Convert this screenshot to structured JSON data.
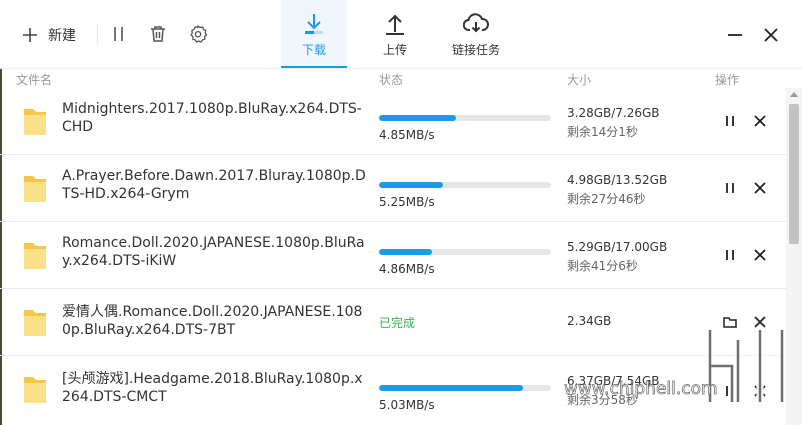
{
  "toolbar": {
    "new_label": "新建",
    "pause_icon": "pause-all-icon",
    "delete_icon": "trash-icon",
    "settings_icon": "gear-icon"
  },
  "tabs": [
    {
      "label": "下载",
      "icon": "download-icon",
      "active": true
    },
    {
      "label": "上传",
      "icon": "upload-icon",
      "active": false
    },
    {
      "label": "链接任务",
      "icon": "cloud-download-icon",
      "active": false
    }
  ],
  "columns": {
    "name": "文件名",
    "status": "状态",
    "size": "大小",
    "action": "操作"
  },
  "rows": [
    {
      "name": "Midnighters.2017.1080p.BluRay.x264.DTS-CHD",
      "speed": "4.85MB/s",
      "progress": 0.45,
      "size": "3.28GB/7.26GB",
      "remaining": "剩余14分1秒"
    },
    {
      "name": "A.Prayer.Before.Dawn.2017.Bluray.1080p.DTS-HD.x264-Grym",
      "speed": "5.25MB/s",
      "progress": 0.37,
      "size": "4.98GB/13.52GB",
      "remaining": "剩余27分46秒"
    },
    {
      "name": "Romance.Doll.2020.JAPANESE.1080p.BluRay.x264.DTS-iKiW",
      "speed": "4.86MB/s",
      "progress": 0.31,
      "size": "5.29GB/17.00GB",
      "remaining": "剩余41分6秒"
    },
    {
      "name": "爱情人偶.Romance.Doll.2020.JAPANESE.1080p.BluRay.x264.DTS-7BT",
      "status": "已完成",
      "size": "2.34GB"
    },
    {
      "name": "[头颅游戏].Headgame.2018.BluRay.1080p.x264.DTS-CMCT",
      "speed": "5.03MB/s",
      "progress": 0.84,
      "size": "6.37GB/7.54GB",
      "remaining": "剩余3分58秒"
    }
  ],
  "watermark": "www.chiphell.com",
  "colors": {
    "accent": "#1a9be8",
    "done": "#3fae5c",
    "folder": "#f5c64a"
  }
}
